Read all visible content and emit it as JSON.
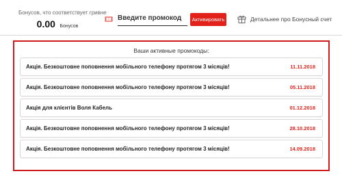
{
  "bonus": {
    "caption": "Бонусов, что соответствует гривне",
    "value": "0.00",
    "unit": "Бонусов"
  },
  "promo_input": {
    "placeholder": "Введите промокод",
    "activate_label": "Активировать"
  },
  "details_link": "Детальнее про Бонусный счет",
  "active_promos": {
    "title": "Ваши активные промокоды:",
    "items": [
      {
        "name": "Акція. Безкоштовне поповнення мобільного телефону протягом 3 місяців!",
        "date": "11.11.2018"
      },
      {
        "name": "Акція. Безкоштовне поповнення мобільного телефону протягом 3 місяців!",
        "date": "05.11.2018"
      },
      {
        "name": "Акція для клієнтів Воля Кабель",
        "date": "01.12.2018"
      },
      {
        "name": "Акція. Безкоштовне поповнення мобільного телефону протягом 3 місяців!",
        "date": "28.10.2018"
      },
      {
        "name": "Акція. Безкоштовне поповнення мобільного телефону протягом 3 місяців!",
        "date": "14.09.2018"
      }
    ]
  },
  "colors": {
    "accent": "#e3211b",
    "panel_border": "#d11a1a"
  },
  "icons": {
    "promo": "ticket-icon",
    "details": "gift-icon"
  }
}
